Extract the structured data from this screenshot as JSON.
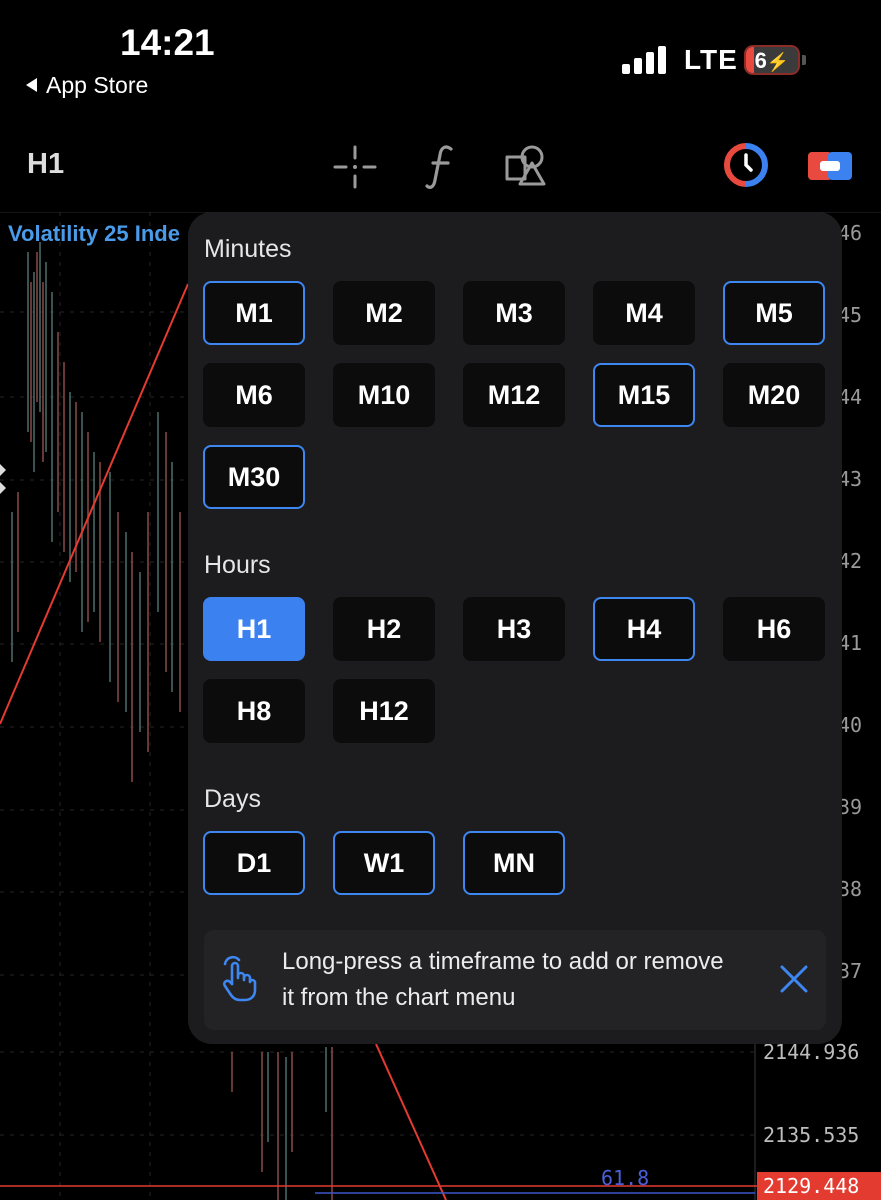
{
  "status_bar": {
    "time": "14:21",
    "back_label": "App Store",
    "network": "LTE",
    "battery": "6"
  },
  "toolbar": {
    "timeframe": "H1",
    "icons": [
      "crosshair-icon",
      "function-icon",
      "shapes-icon",
      "clock-icon",
      "trade-icon"
    ]
  },
  "chart": {
    "instrument": "Volatility 25 Inde",
    "price_edges": [
      "46",
      "45",
      "44",
      "43",
      "42",
      "41",
      "40",
      "39",
      "38",
      "37"
    ],
    "prices": [
      "2144.936",
      "2135.535"
    ],
    "current_price": "2129.448",
    "fib_label": "61.8"
  },
  "timeframe_panel": {
    "sections": {
      "minutes": "Minutes",
      "hours": "Hours",
      "days": "Days"
    },
    "minutes": [
      "M1",
      "M2",
      "M3",
      "M4",
      "M5",
      "M6",
      "M10",
      "M12",
      "M15",
      "M20",
      "M30"
    ],
    "hours": [
      "H1",
      "H2",
      "H3",
      "H4",
      "H6",
      "H8",
      "H12"
    ],
    "days": [
      "D1",
      "W1",
      "MN"
    ],
    "selected": "H1",
    "in_chart_menu": [
      "M1",
      "M5",
      "M15",
      "M30",
      "H1",
      "H4",
      "D1",
      "W1",
      "MN"
    ],
    "hint": "Long-press a timeframe to add or remove it from the chart menu"
  },
  "colors": {
    "accent": "#3b82f0",
    "instrument_text": "#4a9be8",
    "current_price_bg": "#e43b31"
  }
}
